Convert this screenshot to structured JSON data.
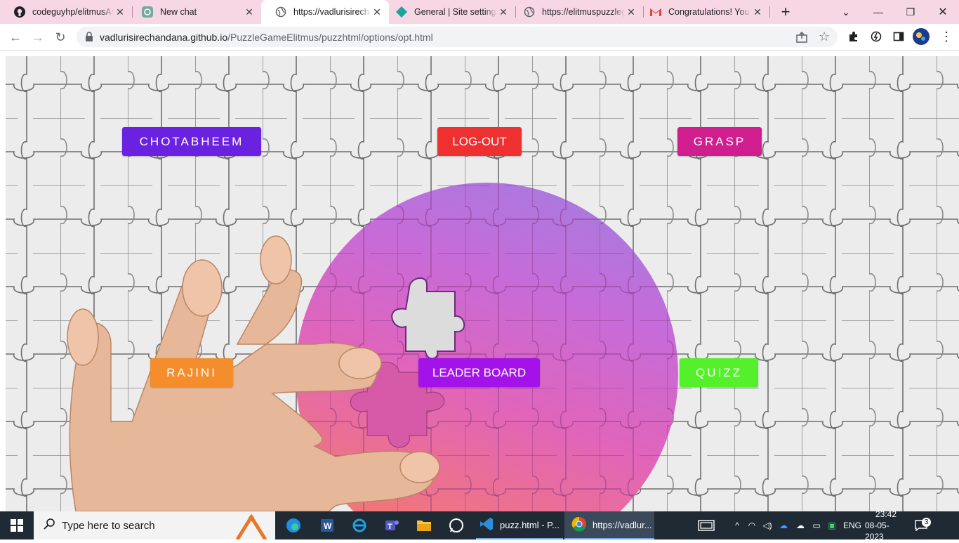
{
  "browser": {
    "tabs": [
      {
        "title": "codeguyhp/elitmusAssignment",
        "icon": "github-icon",
        "active": false
      },
      {
        "title": "New chat",
        "icon": "chatgpt-icon",
        "active": false
      },
      {
        "title": "https://vadlurisirechandana.github.io",
        "icon": "globe-icon",
        "active": true
      },
      {
        "title": "General | Site settings",
        "icon": "diamond-icon",
        "active": false
      },
      {
        "title": "https://elitmuspuzzlegame",
        "icon": "globe-icon",
        "active": false
      },
      {
        "title": "Congratulations! You are",
        "icon": "gmail-icon",
        "active": false
      }
    ],
    "url_domain": "vadlurisirechandana.github.io",
    "url_path": "/PuzzleGameElitmus/puzzhtml/options/opt.html"
  },
  "page": {
    "buttons": {
      "chotabheem": {
        "label": "CHOTABHEEM",
        "color": "#6a22e0"
      },
      "logout": {
        "label": "LOG-OUT",
        "color": "#ee3030"
      },
      "grasp": {
        "label": "GRASP",
        "color": "#d01e8f"
      },
      "rajini": {
        "label": "RAJINI",
        "color": "#f48d2c"
      },
      "leaderboard": {
        "label": "LEADER BOARD",
        "color": "#a312e8"
      },
      "quizz": {
        "label": "QUIZZ",
        "color": "#55f02c"
      }
    }
  },
  "taskbar": {
    "search_placeholder": "Type here to search",
    "apps": [
      {
        "label": "puzz.html - P...",
        "icon": "vscode-icon"
      },
      {
        "label": "https://vadlur...",
        "icon": "chrome-icon"
      }
    ],
    "language": "ENG",
    "time": "23:42",
    "date": "08-05-2023",
    "notifications": "3"
  }
}
